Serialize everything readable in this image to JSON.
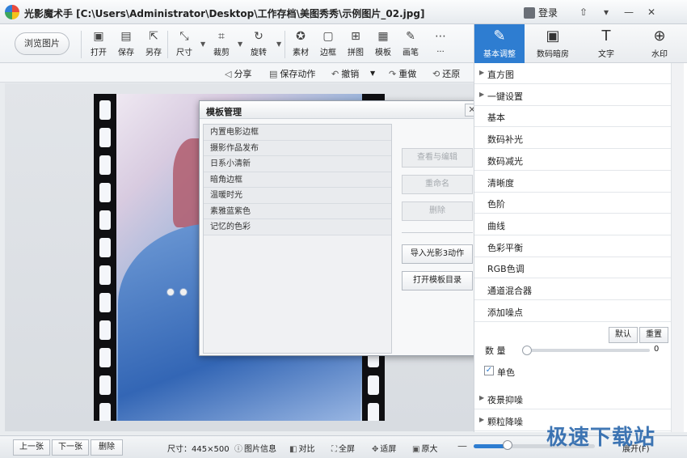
{
  "app": {
    "title": "光影魔术手 [C:\\Users\\Administrator\\Desktop\\工作存档\\美图秀秀\\示例图片_02.jpg]",
    "login": "登录",
    "window_buttons": [
      "⇧",
      "▾",
      "—",
      "✕"
    ]
  },
  "toolbar": {
    "browse": "浏览图片",
    "tools": [
      {
        "label": "打开",
        "icon": "open-icon",
        "glyph": "▣"
      },
      {
        "label": "保存",
        "icon": "save-icon",
        "glyph": "▤"
      },
      {
        "label": "另存",
        "icon": "save-as-icon",
        "glyph": "⇱"
      },
      {
        "label": "尺寸",
        "icon": "resize-icon",
        "glyph": "⤡"
      },
      {
        "label": "裁剪",
        "icon": "crop-icon",
        "glyph": "⌗"
      },
      {
        "label": "旋转",
        "icon": "rotate-icon",
        "glyph": "↻"
      },
      {
        "label": "素材",
        "icon": "material-icon",
        "glyph": "✪"
      },
      {
        "label": "边框",
        "icon": "border-icon",
        "glyph": "▢"
      },
      {
        "label": "拼图",
        "icon": "collage-icon",
        "glyph": "⊞"
      },
      {
        "label": "模板",
        "icon": "template-icon",
        "glyph": "▦"
      },
      {
        "label": "画笔",
        "icon": "brush-icon",
        "glyph": "✎"
      },
      {
        "label": "...",
        "icon": "more-icon",
        "glyph": "⋯"
      }
    ]
  },
  "actions": [
    {
      "label": "分享",
      "icon": "share-icon",
      "glyph": "◁"
    },
    {
      "label": "保存动作",
      "icon": "save-action-icon",
      "glyph": "▤"
    },
    {
      "label": "撤销",
      "icon": "undo-icon",
      "glyph": "↶"
    },
    {
      "label": "重做",
      "icon": "redo-icon",
      "glyph": "↷"
    },
    {
      "label": "还原",
      "icon": "restore-icon",
      "glyph": "⟲"
    }
  ],
  "dialog": {
    "title": "模板管理",
    "close": "✕",
    "templates": [
      "内置电影边框",
      "摄影作品发布",
      "日系小清新",
      "暗角边框",
      "温暖时光",
      "素雅蓝紫色",
      "记忆的色彩"
    ],
    "buttons": {
      "view_edit": "查看与编辑",
      "rename": "重命名",
      "delete": "删除",
      "import": "导入光影3动作",
      "open_dir": "打开模板目录"
    }
  },
  "right_tabs": [
    {
      "label": "基本调整",
      "icon": "edit-adjust-icon",
      "glyph": "✎",
      "active": true
    },
    {
      "label": "数码暗房",
      "icon": "darkroom-icon",
      "glyph": "▣",
      "active": false
    },
    {
      "label": "文字",
      "icon": "text-icon",
      "glyph": "T",
      "active": false
    },
    {
      "label": "水印",
      "icon": "watermark-icon",
      "glyph": "⊕",
      "active": false
    }
  ],
  "right_panel": {
    "items": [
      "直方图",
      "一键设置",
      "基本",
      "数码补光",
      "数码减光",
      "清晰度",
      "色阶",
      "曲线",
      "色彩平衡",
      "RGB色调",
      "通道混合器",
      "添加噪点"
    ],
    "buttons": {
      "default": "默认",
      "reset": "重置"
    },
    "amount": {
      "label": "数   量",
      "value": "0"
    },
    "mono": {
      "label": "单色",
      "checked": true
    },
    "bottom_items": [
      "夜景抑噪",
      "颗粒降噪"
    ]
  },
  "status": {
    "prev": "上一张",
    "next": "下一张",
    "delete": "删除",
    "size": "尺寸：445×500",
    "info": "图片信息",
    "compare": "对比",
    "fullscreen": "全屏",
    "fit": "适屏",
    "original": "原大",
    "expand": "展开(F)",
    "zoom_fraction": 0.28
  },
  "watermark_text": "极速下载站"
}
